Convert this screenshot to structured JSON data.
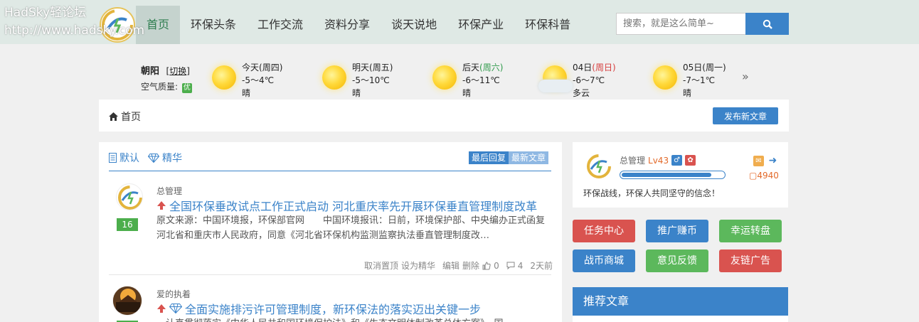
{
  "watermark": {
    "line1": "HadSky轻论坛",
    "line2": "http://www.hadsky.com"
  },
  "nav": {
    "items": [
      {
        "label": "首页",
        "active": true
      },
      {
        "label": "环保头条"
      },
      {
        "label": "工作交流"
      },
      {
        "label": "资料分享"
      },
      {
        "label": "谈天说地"
      },
      {
        "label": "环保产业"
      },
      {
        "label": "环保科普"
      }
    ]
  },
  "search": {
    "placeholder": "搜索，就是这么简单~",
    "icon": "search-icon"
  },
  "weather": {
    "city": "朝阳",
    "switch_label": "切换",
    "aq_label": "空气质量:",
    "aq_value": "优",
    "days": [
      {
        "name": "今天",
        "weekday": "(周四)",
        "temp": "-5～4℃",
        "cond": "晴",
        "icon": "sun-icon"
      },
      {
        "name": "明天",
        "weekday": "(周五)",
        "temp": "-5～10℃",
        "cond": "晴",
        "icon": "sun-icon"
      },
      {
        "name": "后天",
        "weekday": "(周六)",
        "temp": "-6～11℃",
        "cond": "晴",
        "icon": "sun-icon"
      },
      {
        "name": "04日",
        "weekday": "(周日)",
        "temp": "-6～7℃",
        "cond": "多云",
        "icon": "cloud-sun-icon"
      },
      {
        "name": "05日",
        "weekday": "(周一)",
        "temp": "-7～1℃",
        "cond": "晴",
        "icon": "sun-icon"
      }
    ],
    "more": "»"
  },
  "breadcrumb": {
    "home": "首页"
  },
  "publish_label": "发布新文章",
  "tabs": {
    "default": "默认",
    "featured": "精华"
  },
  "sort": {
    "last_reply": "最后回复",
    "newest": "最新文章"
  },
  "posts": [
    {
      "author": "总管理",
      "title": "全国环保垂改试点工作正式启动 河北重庆率先开展环保垂直管理制度改革",
      "excerpt": "原文来源：中国环境报，环保部官网　　中国环境报讯：日前，环境保护部、中央编办正式函复河北省和重庆市人民政府，同意《河北省环保机构监测监察执法垂直管理制度改…",
      "replies": "16",
      "actions": [
        "取消置顶",
        "设为精华",
        "编辑",
        "删除"
      ],
      "likes": "0",
      "comments": "4",
      "time": "2天前"
    },
    {
      "author": "爱的执着",
      "title": "全面实施排污许可管理制度，新环保法的落实迈出关键一步",
      "excerpt": "　认真贯彻落实《中华人民共和国环境保护法》和《生态文明体制改革总体方案》，国"
    }
  ],
  "user": {
    "name": "总管理",
    "level": "Lv43",
    "xp_fraction": 0.88,
    "points": "4940",
    "motto": "环保战线，环保人共同坚守的信念！"
  },
  "sidebar_buttons": [
    {
      "label": "任务中心",
      "color": "#d9534f"
    },
    {
      "label": "推广赚币",
      "color": "#3b83c9"
    },
    {
      "label": "幸运转盘",
      "color": "#5cb85c"
    },
    {
      "label": "战币商城",
      "color": "#3b83c9"
    },
    {
      "label": "意见反馈",
      "color": "#5cb85c"
    },
    {
      "label": "友链广告",
      "color": "#d9534f"
    }
  ],
  "recommend_title": "推荐文章"
}
